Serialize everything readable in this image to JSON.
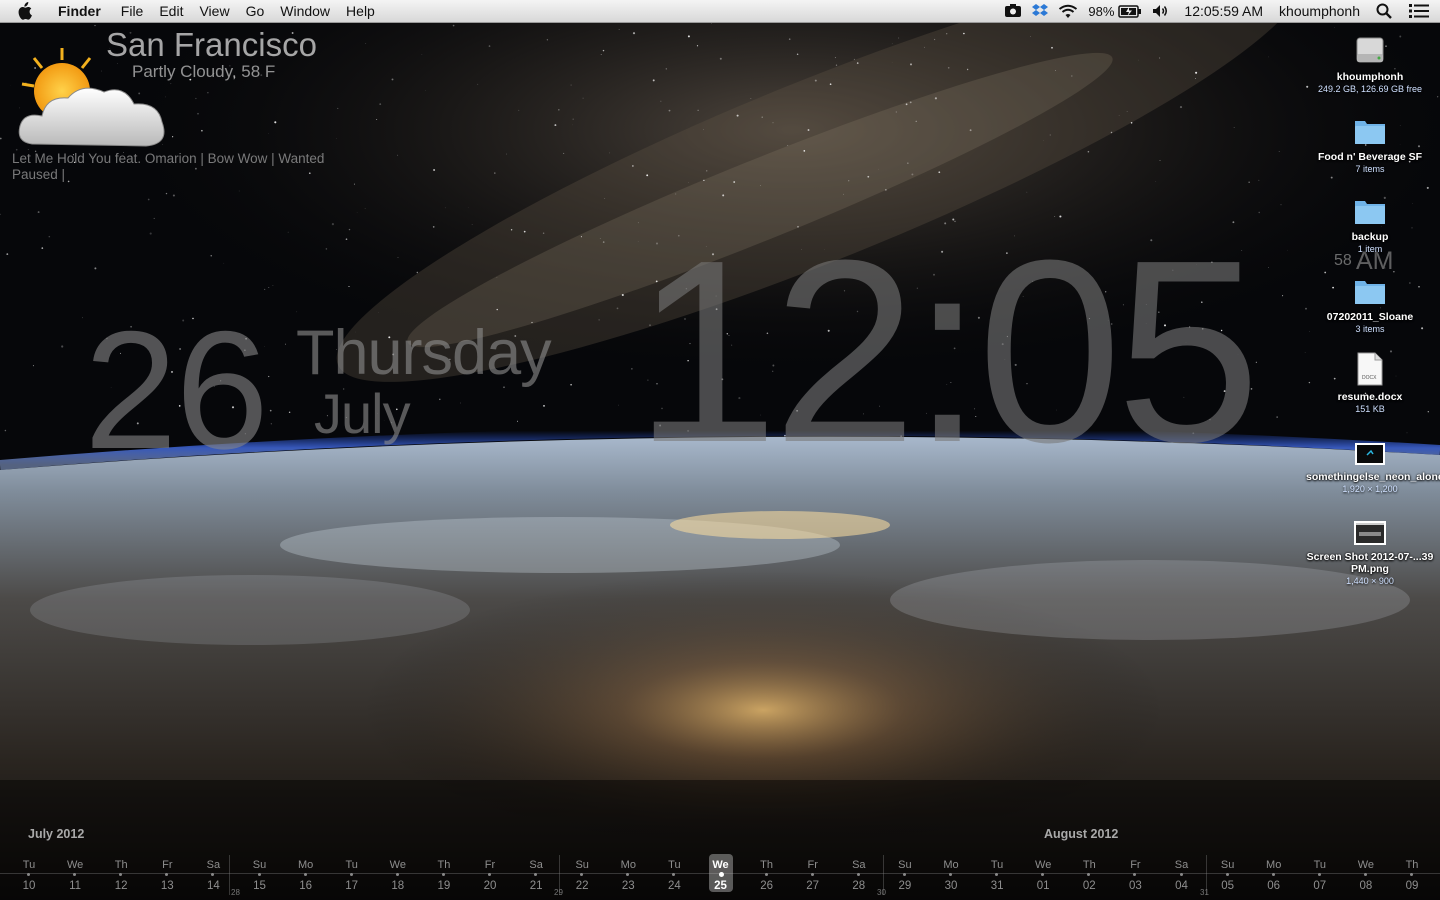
{
  "menubar": {
    "app_name": "Finder",
    "menus": [
      "File",
      "Edit",
      "View",
      "Go",
      "Window",
      "Help"
    ],
    "battery_percent": "98%",
    "clock": "12:05:59 AM",
    "user": "khoumphonh"
  },
  "weather": {
    "city": "San Francisco",
    "condition": "Partly Cloudy, 58 F",
    "icon": "partly-cloudy-icon"
  },
  "now_playing": {
    "line1": "Let Me Hold You feat. Omarion | Bow Wow | Wanted",
    "line2": "Paused |"
  },
  "big_clock": {
    "day_number": "26",
    "weekday": "Thursday",
    "month": "July",
    "time": "12:05",
    "seconds": "58",
    "ampm": "AM"
  },
  "desktop_icons": [
    {
      "name": "khoumphonh",
      "info": "249.2 GB, 126.69 GB free",
      "icon": "hard-drive-icon"
    },
    {
      "name": "Food n' Beverage SF",
      "info": "7 items",
      "icon": "folder-icon"
    },
    {
      "name": "backup",
      "info": "1 item",
      "icon": "folder-icon"
    },
    {
      "name": "07202011_Sloane",
      "info": "3 items",
      "icon": "folder-icon"
    },
    {
      "name": "resume.docx",
      "info": "151 KB",
      "icon": "docx-file-icon"
    },
    {
      "name": "somethingelse_neon_alone.jpg",
      "info": "1,920 × 1,200",
      "icon": "image-file-icon"
    },
    {
      "name": "Screen Shot 2012-07-...39 PM.png",
      "info": "1,440 × 900",
      "icon": "screenshot-file-icon"
    }
  ],
  "calendar": {
    "month_left": "July 2012",
    "month_right": "August 2012",
    "days": [
      {
        "dn": "Tu",
        "dd": "10"
      },
      {
        "dn": "We",
        "dd": "11"
      },
      {
        "dn": "Th",
        "dd": "12"
      },
      {
        "dn": "Fr",
        "dd": "13"
      },
      {
        "dn": "Sa",
        "dd": "14"
      },
      {
        "dn": "Su",
        "dd": "15"
      },
      {
        "dn": "Mo",
        "dd": "16"
      },
      {
        "dn": "Tu",
        "dd": "17"
      },
      {
        "dn": "We",
        "dd": "18"
      },
      {
        "dn": "Th",
        "dd": "19"
      },
      {
        "dn": "Fr",
        "dd": "20"
      },
      {
        "dn": "Sa",
        "dd": "21"
      },
      {
        "dn": "Su",
        "dd": "22"
      },
      {
        "dn": "Mo",
        "dd": "23"
      },
      {
        "dn": "Tu",
        "dd": "24"
      },
      {
        "dn": "We",
        "dd": "25",
        "today": true
      },
      {
        "dn": "Th",
        "dd": "26"
      },
      {
        "dn": "Fr",
        "dd": "27"
      },
      {
        "dn": "Sa",
        "dd": "28"
      },
      {
        "dn": "Su",
        "dd": "29"
      },
      {
        "dn": "Mo",
        "dd": "30"
      },
      {
        "dn": "Tu",
        "dd": "31"
      },
      {
        "dn": "We",
        "dd": "01"
      },
      {
        "dn": "Th",
        "dd": "02"
      },
      {
        "dn": "Fr",
        "dd": "03"
      },
      {
        "dn": "Sa",
        "dd": "04"
      },
      {
        "dn": "Su",
        "dd": "05"
      },
      {
        "dn": "Mo",
        "dd": "06"
      },
      {
        "dn": "Tu",
        "dd": "07"
      },
      {
        "dn": "We",
        "dd": "08"
      },
      {
        "dn": "Th",
        "dd": "09"
      }
    ],
    "week_numbers": [
      "28",
      "29",
      "30",
      "31"
    ]
  }
}
